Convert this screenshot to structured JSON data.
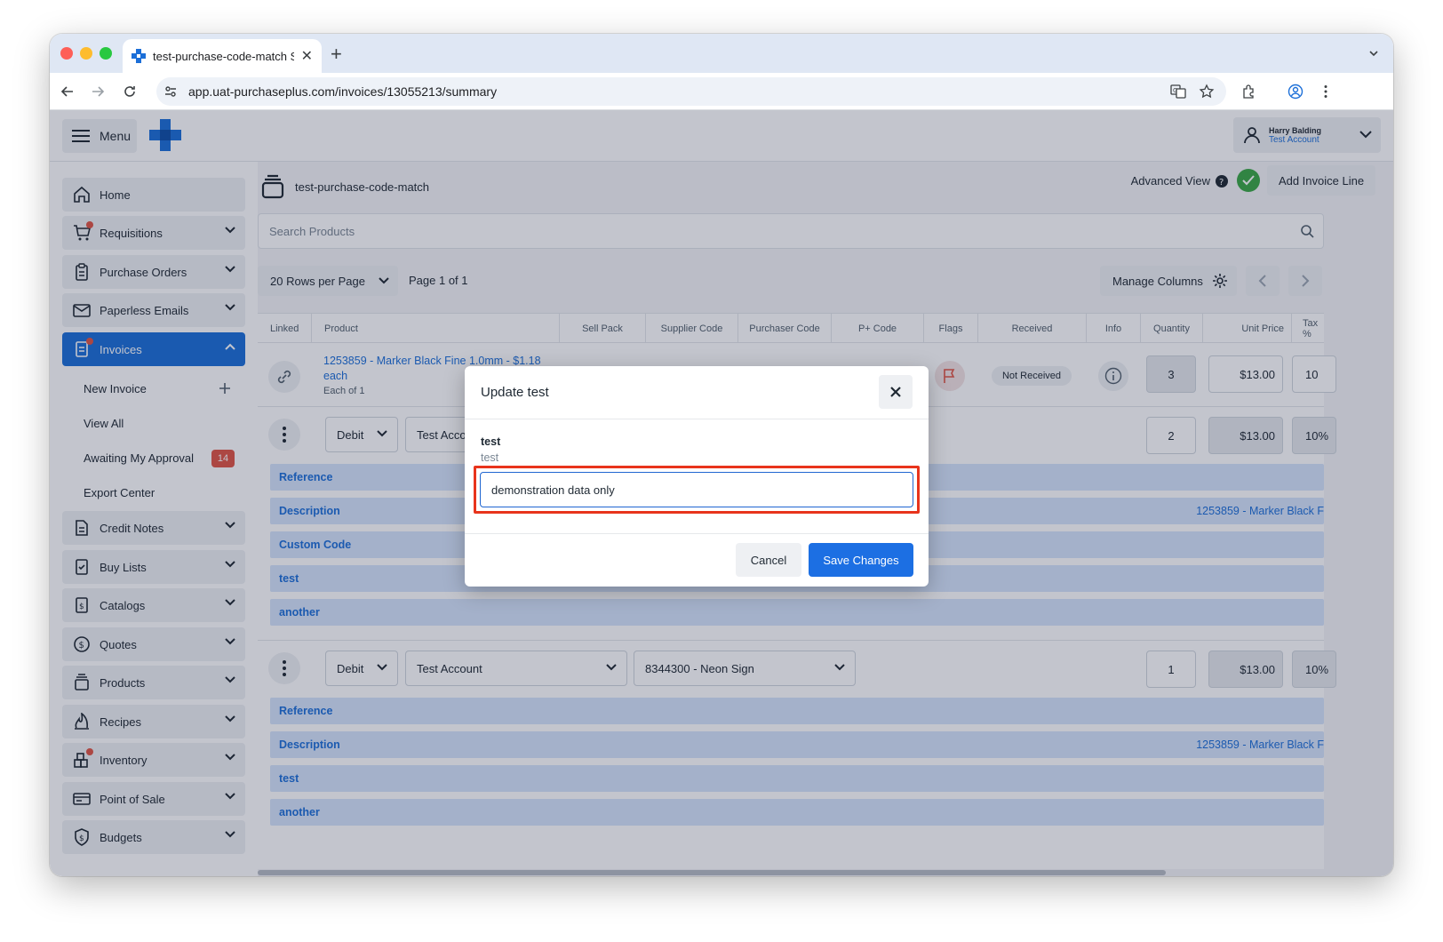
{
  "browser": {
    "tab_title": "test-purchase-code-match S",
    "url": "app.uat-purchaseplus.com/invoices/13055213/summary"
  },
  "colors": {
    "brand": "#1c6fd8",
    "danger": "#e05545",
    "highlight": "#e8341c",
    "success": "#3aa845"
  },
  "topbar": {
    "menu_label": "Menu",
    "user_name": "Harry Balding",
    "user_account": "Test Account"
  },
  "sidebar": {
    "items": [
      {
        "label": "Home",
        "icon": "home-icon"
      },
      {
        "label": "Requisitions",
        "icon": "cart-icon"
      },
      {
        "label": "Purchase Orders",
        "icon": "clipboard-icon"
      },
      {
        "label": "Paperless Emails",
        "icon": "mail-icon"
      },
      {
        "label": "Invoices",
        "icon": "invoice-icon"
      },
      {
        "label": "Credit Notes",
        "icon": "document-icon"
      },
      {
        "label": "Buy Lists",
        "icon": "checklist-icon"
      },
      {
        "label": "Catalogs",
        "icon": "catalog-icon"
      },
      {
        "label": "Quotes",
        "icon": "dollar-icon"
      },
      {
        "label": "Products",
        "icon": "stack-icon"
      },
      {
        "label": "Recipes",
        "icon": "flame-icon"
      },
      {
        "label": "Inventory",
        "icon": "boxes-icon"
      },
      {
        "label": "Point of Sale",
        "icon": "card-icon"
      },
      {
        "label": "Budgets",
        "icon": "shield-dollar-icon"
      }
    ],
    "invoice_sub": {
      "new_invoice": "New Invoice",
      "view_all": "View All",
      "awaiting": "Awaiting My Approval",
      "awaiting_count": "14",
      "export": "Export Center"
    }
  },
  "main": {
    "title": "test-purchase-code-match",
    "advanced_view": "Advanced View",
    "add_invoice_line": "Add Invoice Line",
    "search_placeholder": "Search Products",
    "rows_per_page": "20 Rows per Page",
    "page_of": "Page 1 of 1",
    "manage_columns": "Manage Columns",
    "columns": [
      "Linked",
      "Product",
      "Sell Pack",
      "Supplier Code",
      "Purchaser Code",
      "P+ Code",
      "Flags",
      "Received",
      "Info",
      "Quantity",
      "Unit Price",
      "Tax %"
    ],
    "row": {
      "product": "1253859 - Marker Black Fine 1.0mm - $1.18 each",
      "each_of": "Each of 1",
      "received": "Not Received",
      "quantity": "3",
      "unit_price": "$13.00",
      "tax": "10"
    },
    "line1": {
      "type": "Debit",
      "account": "Test Acco",
      "quantity": "2",
      "unit_price": "$13.00",
      "tax": "10%",
      "details": [
        "Reference",
        "Description",
        "Custom Code",
        "test",
        "another"
      ],
      "description_value": "1253859 - Marker Black F"
    },
    "line2": {
      "type": "Debit",
      "account": "Test Account",
      "code": "8344300 - Neon Sign",
      "quantity": "1",
      "unit_price": "$13.00",
      "tax": "10%",
      "details": [
        "Reference",
        "Description",
        "test",
        "another"
      ],
      "description_value": "1253859 - Marker Black F"
    }
  },
  "modal": {
    "title": "Update test",
    "field_label": "test",
    "field_help": "test",
    "field_value": "demonstration data only",
    "cancel": "Cancel",
    "save": "Save Changes"
  }
}
